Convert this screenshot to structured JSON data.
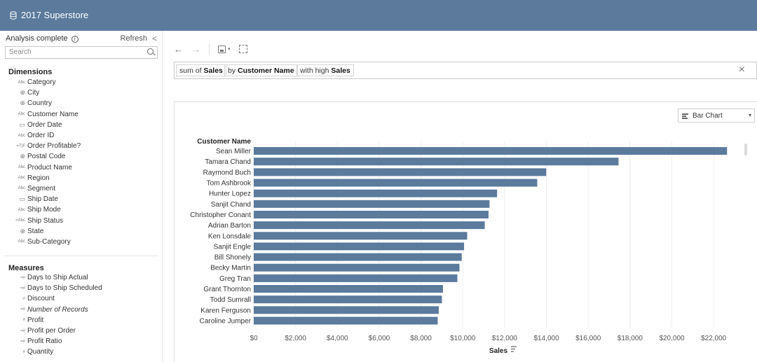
{
  "app": {
    "title": "2017 Superstore",
    "icon": "database-icon"
  },
  "sidebar": {
    "status": "Analysis complete",
    "refresh_label": "Refresh",
    "collapse_glyph": "<",
    "search_placeholder": "Search",
    "dimensions_title": "Dimensions",
    "dimensions": [
      {
        "type": "Abc",
        "icon": "string-icon",
        "label": "Category"
      },
      {
        "type": "globe",
        "icon": "globe-icon",
        "label": "City"
      },
      {
        "type": "globe",
        "icon": "globe-icon",
        "label": "Country"
      },
      {
        "type": "Abc",
        "icon": "string-icon",
        "label": "Customer Name"
      },
      {
        "type": "cal",
        "icon": "calendar-icon",
        "label": "Order Date"
      },
      {
        "type": "Abc",
        "icon": "string-icon",
        "label": "Order ID"
      },
      {
        "type": "=T|F",
        "icon": "boolean-calc-icon",
        "label": "Order Profitable?"
      },
      {
        "type": "globe",
        "icon": "globe-icon",
        "label": "Postal Code"
      },
      {
        "type": "Abc",
        "icon": "string-icon",
        "label": "Product Name"
      },
      {
        "type": "Abc",
        "icon": "string-icon",
        "label": "Region"
      },
      {
        "type": "Abc",
        "icon": "string-icon",
        "label": "Segment"
      },
      {
        "type": "cal",
        "icon": "calendar-icon",
        "label": "Ship Date"
      },
      {
        "type": "Abc",
        "icon": "string-icon",
        "label": "Ship Mode"
      },
      {
        "type": "=Abc",
        "icon": "string-calc-icon",
        "label": "Ship Status"
      },
      {
        "type": "globe",
        "icon": "globe-icon",
        "label": "State"
      },
      {
        "type": "Abc",
        "icon": "string-icon",
        "label": "Sub-Category"
      }
    ],
    "measures_title": "Measures",
    "measures": [
      {
        "type": "=#",
        "icon": "number-calc-icon",
        "label": "Days to Ship Actual",
        "italic": false
      },
      {
        "type": "=#",
        "icon": "number-calc-icon",
        "label": "Days to Ship Scheduled",
        "italic": false
      },
      {
        "type": "#",
        "icon": "number-icon",
        "label": "Discount",
        "italic": false
      },
      {
        "type": "=#",
        "icon": "number-calc-icon",
        "label": "Number of Records",
        "italic": true
      },
      {
        "type": "#",
        "icon": "number-icon",
        "label": "Profit",
        "italic": false
      },
      {
        "type": "=#",
        "icon": "number-calc-icon",
        "label": "Profit per Order",
        "italic": false
      },
      {
        "type": "=#",
        "icon": "number-calc-icon",
        "label": "Profit Ratio",
        "italic": false
      },
      {
        "type": "#",
        "icon": "number-icon",
        "label": "Quantity",
        "italic": false
      }
    ]
  },
  "toolbar": {
    "back_glyph": "←",
    "forward_glyph": "→",
    "caret_glyph": "▾",
    "icons": [
      "back-arrow-icon",
      "forward-arrow-icon",
      "save-icon",
      "fit-icon"
    ]
  },
  "question": {
    "chips": [
      {
        "prefix": "sum of ",
        "bold": "Sales"
      },
      {
        "prefix": "by ",
        "bold": "Customer Name"
      },
      {
        "prefix": "with high ",
        "bold": "Sales"
      }
    ],
    "clear_glyph": "×"
  },
  "viz_type": {
    "label": "Bar Chart",
    "icon": "bar-chart-icon",
    "caret": "▾"
  },
  "chart_data": {
    "type": "bar",
    "orientation": "horizontal",
    "color": "#5b7a9c",
    "category_label": "Customer Name",
    "xlabel": "Sales",
    "xlim": [
      0,
      23000
    ],
    "xticks": [
      "$0",
      "$2,000",
      "$4,000",
      "$6,000",
      "$8,000",
      "$10,000",
      "$12,000",
      "$14,000",
      "$16,000",
      "$18,000",
      "$20,000",
      "$22,000"
    ],
    "categories": [
      "Sean Miller",
      "Tamara Chand",
      "Raymond Buch",
      "Tom Ashbrook",
      "Hunter Lopez",
      "Sanjit Chand",
      "Christopher Conant",
      "Adrian Barton",
      "Ken Lonsdale",
      "Sanjit Engle",
      "Bill Shonely",
      "Becky Martin",
      "Greg Tran",
      "Grant Thornton",
      "Todd Sumrall",
      "Karen Ferguson",
      "Caroline Jumper"
    ],
    "values": [
      22640,
      17450,
      13990,
      13560,
      11640,
      11280,
      11230,
      11050,
      10210,
      10060,
      9950,
      9840,
      9740,
      9050,
      9000,
      8850,
      8800
    ],
    "grid": true
  }
}
